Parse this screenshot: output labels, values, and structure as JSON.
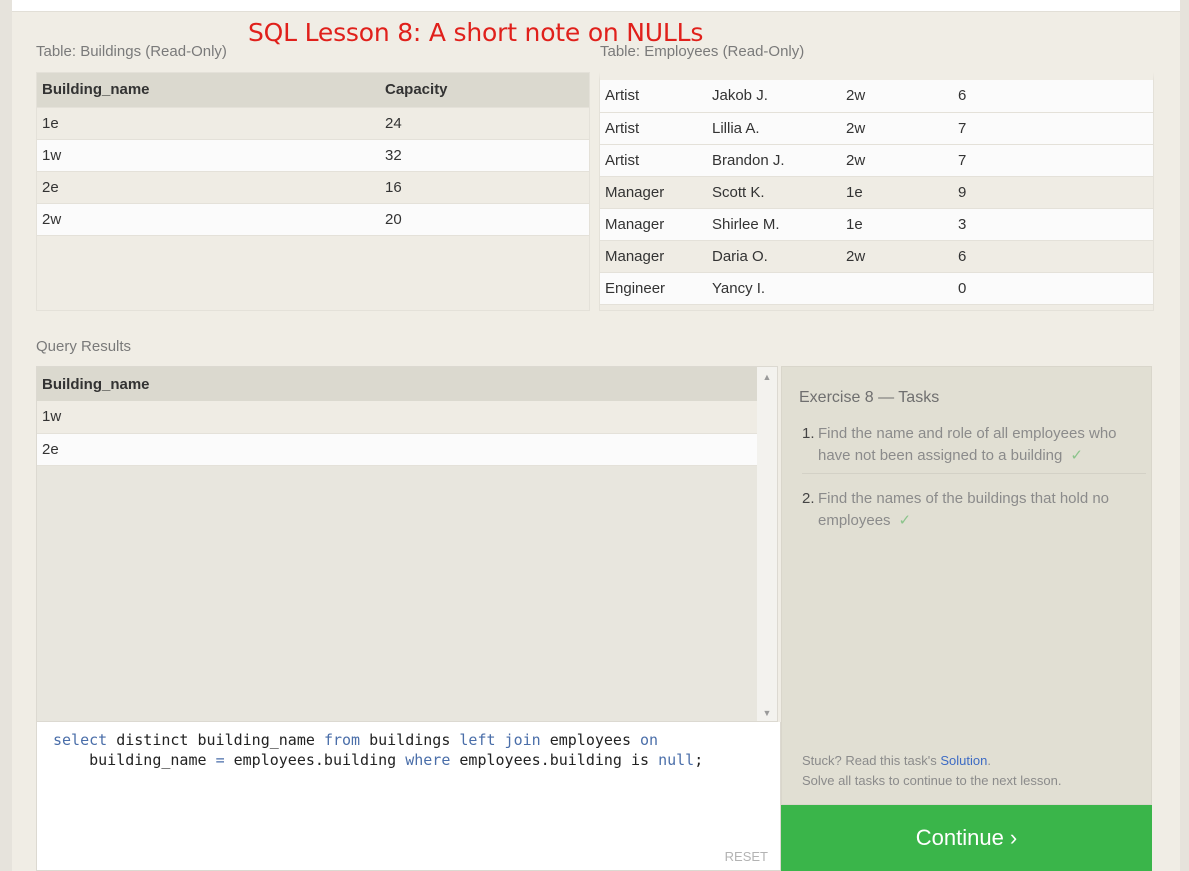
{
  "overlay_title": "SQL Lesson 8: A short note on NULLs",
  "buildings_table": {
    "caption": "Table: Buildings (Read-Only)",
    "headers": [
      "Building_name",
      "Capacity"
    ],
    "rows": [
      [
        "1e",
        "24"
      ],
      [
        "1w",
        "32"
      ],
      [
        "2e",
        "16"
      ],
      [
        "2w",
        "20"
      ]
    ]
  },
  "employees_table": {
    "caption": "Table: Employees (Read-Only)",
    "rows": [
      [
        "Artist",
        "Jakob J.",
        "2w",
        "6"
      ],
      [
        "Artist",
        "Lillia A.",
        "2w",
        "7"
      ],
      [
        "Artist",
        "Brandon J.",
        "2w",
        "7"
      ],
      [
        "Manager",
        "Scott K.",
        "1e",
        "9"
      ],
      [
        "Manager",
        "Shirlee M.",
        "1e",
        "3"
      ],
      [
        "Manager",
        "Daria O.",
        "2w",
        "6"
      ],
      [
        "Engineer",
        "Yancy I.",
        "",
        "0"
      ]
    ]
  },
  "query_results": {
    "caption": "Query Results",
    "headers": [
      "Building_name"
    ],
    "rows": [
      [
        "1w"
      ],
      [
        "2e"
      ]
    ]
  },
  "editor": {
    "line1": {
      "kw1": "select",
      "t1": " distinct building_name ",
      "kw2": "from",
      "t2": " buildings ",
      "kw3": "left join",
      "t3": " employees ",
      "kw4": "on"
    },
    "line2": {
      "t1": "    building_name ",
      "kw1": "=",
      "t2": " employees.building ",
      "kw2": "where",
      "t3": " employees.building is ",
      "kw3": "null",
      "t4": ";"
    },
    "reset_label": "RESET"
  },
  "tasks": {
    "title": "Exercise 8 — Tasks",
    "items": [
      {
        "num": "1.",
        "text": "Find the name and role of all employees who have not been assigned to a building",
        "check": "✓"
      },
      {
        "num": "2.",
        "text": "Find the names of the buildings that hold no employees",
        "check": "✓"
      }
    ],
    "stuck_prefix": "Stuck? Read this task's ",
    "solution_link": "Solution",
    "stuck_suffix": ".",
    "solve_all": "Solve all tasks to continue to the next lesson."
  },
  "continue_label": "Continue ›",
  "colors": {
    "accent_green": "#3ab54a",
    "overlay_red": "#e0201b",
    "keyword_blue": "#4a6ea9",
    "link_blue": "#3d6bc4"
  }
}
